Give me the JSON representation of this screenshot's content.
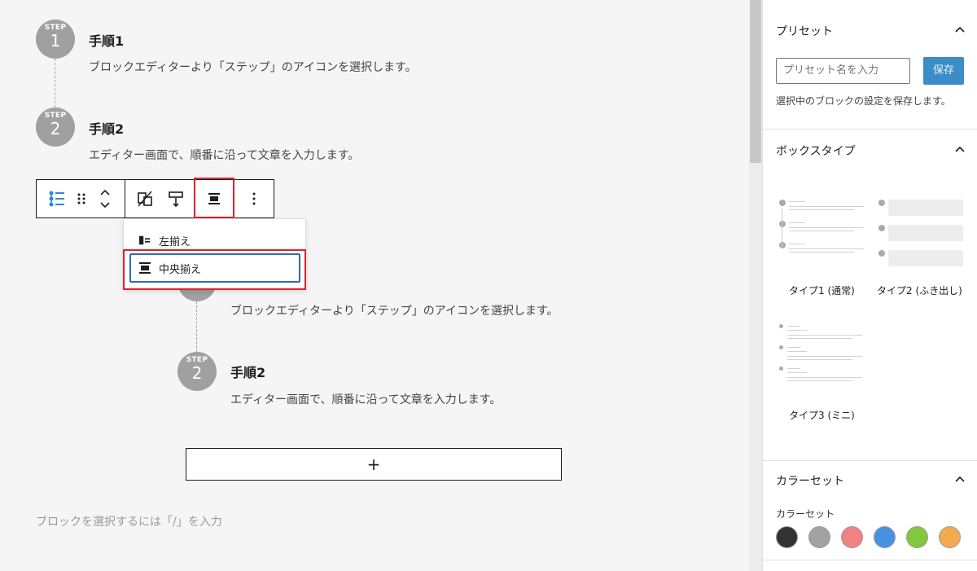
{
  "editor": {
    "top_steps": [
      {
        "step_label": "STEP",
        "num": "1",
        "title": "手順1",
        "text": "ブロックエディターより「ステップ」のアイコンを選択します。"
      },
      {
        "step_label": "STEP",
        "num": "2",
        "title": "手順2",
        "text": "エディター画面で、順番に沿って文章を入力します。"
      }
    ],
    "lower_steps": [
      {
        "text": "ブロックエディターより「ステップ」のアイコンを選択します。"
      },
      {
        "step_label": "STEP",
        "num": "2",
        "title": "手順2",
        "text": "エディター画面で、順番に沿って文章を入力します。"
      }
    ],
    "toolbar": {
      "icons": [
        "list-block-icon",
        "drag-handle-icon",
        "move-up-down-icon",
        "transform-icon",
        "style-icon",
        "align-center-icon",
        "more-options-icon"
      ]
    },
    "align_menu": {
      "left_label": "左揃え",
      "center_label": "中央揃え"
    },
    "appender_symbol": "+",
    "placeholder": "ブロックを選択するには「/」を入力"
  },
  "sidebar": {
    "preset": {
      "title": "プリセット",
      "input_placeholder": "プリセット名を入力",
      "save_label": "保存",
      "help": "選択中のブロックの設定を保存します。"
    },
    "box_type": {
      "title": "ボックスタイプ",
      "options": [
        {
          "label": "タイプ1 (通常)"
        },
        {
          "label": "タイプ2 (ふき出し)"
        },
        {
          "label": "タイプ3 (ミニ)"
        }
      ]
    },
    "color_set": {
      "title": "カラーセット",
      "sub_label": "カラーセット",
      "colors": [
        "#333333",
        "#a2a2a2",
        "#f08282",
        "#4a90e2",
        "#82c83c",
        "#f5aa50"
      ]
    }
  }
}
